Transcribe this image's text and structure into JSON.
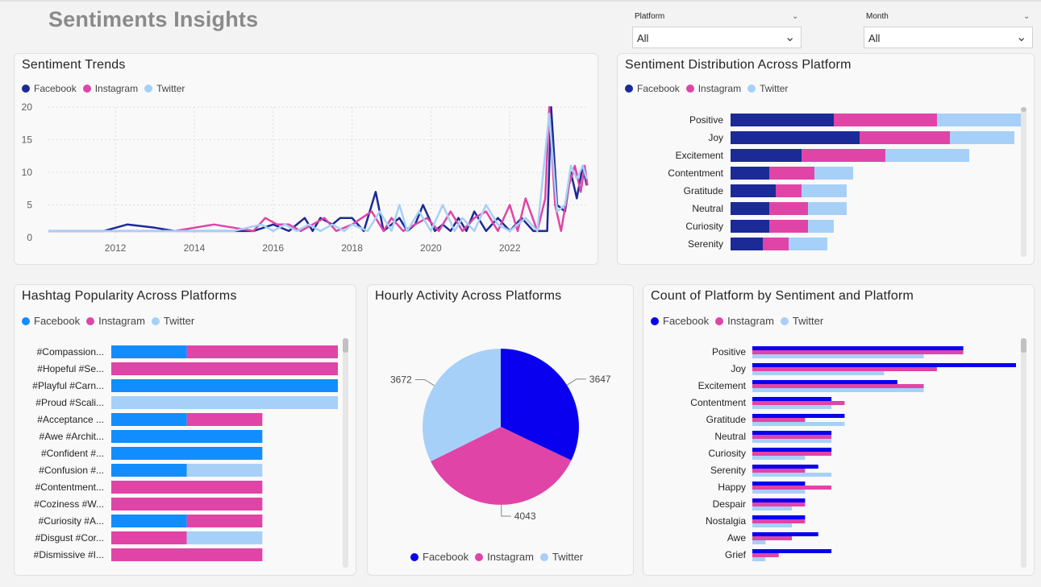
{
  "page": {
    "title": "Sentiments Insights"
  },
  "filters": {
    "platform": {
      "label": "Platform",
      "value": "All"
    },
    "month": {
      "label": "Month",
      "value": "All"
    }
  },
  "colors": {
    "facebook_dark": "#1b2a96",
    "instagram": "#e044a7",
    "twitter": "#a6d0f7",
    "facebook_blue": "#118dff",
    "facebook_bright": "#0a00f0"
  },
  "panels": {
    "trends": {
      "title": "Sentiment Trends"
    },
    "distribution": {
      "title": "Sentiment Distribution Across Platform"
    },
    "hashtags": {
      "title": "Hashtag Popularity Across Platforms"
    },
    "hourly": {
      "title": "Hourly Activity Across Platforms"
    },
    "count": {
      "title": "Count of Platform by Sentiment and Platform"
    }
  },
  "chart_data": [
    {
      "id": "trends",
      "type": "line",
      "title": "Sentiment Trends",
      "legend": [
        "Facebook",
        "Instagram",
        "Twitter"
      ],
      "legend_position": "top-left",
      "x_ticks": [
        "2012",
        "2014",
        "2016",
        "2018",
        "2020",
        "2022"
      ],
      "y_ticks": [
        "0",
        "5",
        "10",
        "15",
        "20"
      ],
      "xlim": [
        2010.3,
        2024.0
      ],
      "ylim": [
        0,
        20
      ],
      "grid": true,
      "series": [
        {
          "name": "Facebook",
          "points": [
            [
              2010.3,
              1
            ],
            [
              2011.0,
              1
            ],
            [
              2011.7,
              1
            ],
            [
              2012.3,
              2
            ],
            [
              2013.0,
              1.5
            ],
            [
              2013.5,
              1
            ],
            [
              2014.5,
              1
            ],
            [
              2015.5,
              1
            ],
            [
              2016.0,
              2
            ],
            [
              2016.4,
              1
            ],
            [
              2016.8,
              3
            ],
            [
              2017.0,
              1
            ],
            [
              2017.2,
              3
            ],
            [
              2017.5,
              2
            ],
            [
              2017.7,
              3
            ],
            [
              2018.0,
              3
            ],
            [
              2018.3,
              1
            ],
            [
              2018.6,
              7
            ],
            [
              2018.8,
              1
            ],
            [
              2019.2,
              3
            ],
            [
              2019.4,
              1
            ],
            [
              2019.6,
              2
            ],
            [
              2019.8,
              5
            ],
            [
              2020.1,
              1
            ],
            [
              2020.3,
              2
            ],
            [
              2020.5,
              1
            ],
            [
              2020.7,
              3
            ],
            [
              2020.9,
              1
            ],
            [
              2021.1,
              4
            ],
            [
              2021.4,
              1
            ],
            [
              2021.7,
              3
            ],
            [
              2022.0,
              1
            ],
            [
              2022.3,
              3
            ],
            [
              2022.6,
              1
            ],
            [
              2022.8,
              1
            ],
            [
              2022.95,
              1
            ],
            [
              2023.05,
              20
            ],
            [
              2023.2,
              5
            ],
            [
              2023.4,
              4
            ],
            [
              2023.55,
              10
            ],
            [
              2023.7,
              6
            ],
            [
              2023.85,
              11
            ],
            [
              2023.95,
              8
            ]
          ]
        },
        {
          "name": "Instagram",
          "points": [
            [
              2010.3,
              1
            ],
            [
              2011.0,
              1
            ],
            [
              2012.0,
              1
            ],
            [
              2013.0,
              1
            ],
            [
              2013.5,
              1
            ],
            [
              2014.5,
              2
            ],
            [
              2015.0,
              1.5
            ],
            [
              2015.5,
              1
            ],
            [
              2015.8,
              3
            ],
            [
              2016.1,
              2
            ],
            [
              2016.4,
              2
            ],
            [
              2016.7,
              1
            ],
            [
              2017.0,
              2
            ],
            [
              2017.3,
              3
            ],
            [
              2017.6,
              1
            ],
            [
              2018.0,
              2
            ],
            [
              2018.5,
              4
            ],
            [
              2018.8,
              1
            ],
            [
              2019.0,
              3
            ],
            [
              2019.3,
              1
            ],
            [
              2019.6,
              2
            ],
            [
              2019.9,
              3
            ],
            [
              2020.2,
              1
            ],
            [
              2020.5,
              4
            ],
            [
              2020.8,
              1
            ],
            [
              2021.1,
              3
            ],
            [
              2021.4,
              4
            ],
            [
              2021.7,
              1
            ],
            [
              2022.0,
              5
            ],
            [
              2022.2,
              1
            ],
            [
              2022.4,
              6
            ],
            [
              2022.7,
              1
            ],
            [
              2022.9,
              6
            ],
            [
              2023.0,
              20
            ],
            [
              2023.15,
              5
            ],
            [
              2023.3,
              1
            ],
            [
              2023.5,
              8
            ],
            [
              2023.65,
              11
            ],
            [
              2023.8,
              7
            ],
            [
              2023.9,
              11
            ],
            [
              2023.97,
              8
            ]
          ]
        },
        {
          "name": "Twitter",
          "points": [
            [
              2010.3,
              1
            ],
            [
              2011.0,
              1
            ],
            [
              2012.0,
              1
            ],
            [
              2013.0,
              1
            ],
            [
              2014.0,
              1
            ],
            [
              2015.0,
              1
            ],
            [
              2015.7,
              2
            ],
            [
              2016.0,
              1
            ],
            [
              2016.3,
              2
            ],
            [
              2016.6,
              1
            ],
            [
              2016.9,
              2
            ],
            [
              2017.2,
              1
            ],
            [
              2017.5,
              2
            ],
            [
              2017.8,
              1
            ],
            [
              2018.0,
              2
            ],
            [
              2018.4,
              1
            ],
            [
              2018.7,
              4
            ],
            [
              2019.0,
              1
            ],
            [
              2019.2,
              5
            ],
            [
              2019.4,
              1
            ],
            [
              2019.7,
              4
            ],
            [
              2020.0,
              1
            ],
            [
              2020.3,
              5
            ],
            [
              2020.6,
              1
            ],
            [
              2020.8,
              3
            ],
            [
              2021.1,
              1
            ],
            [
              2021.4,
              5
            ],
            [
              2021.7,
              2
            ],
            [
              2022.0,
              1
            ],
            [
              2022.4,
              3
            ],
            [
              2022.7,
              1
            ],
            [
              2023.0,
              19
            ],
            [
              2023.2,
              4
            ],
            [
              2023.4,
              5
            ],
            [
              2023.55,
              11
            ],
            [
              2023.7,
              9
            ],
            [
              2023.85,
              11
            ],
            [
              2023.95,
              9
            ]
          ]
        }
      ]
    },
    {
      "id": "distribution",
      "type": "bar",
      "orientation": "horizontal",
      "stacked": true,
      "title": "Sentiment Distribution Across Platform",
      "legend": [
        "Facebook",
        "Instagram",
        "Twitter"
      ],
      "legend_position": "top-left",
      "categories": [
        "Positive",
        "Joy",
        "Excitement",
        "Contentment",
        "Gratitude",
        "Neutral",
        "Curiosity",
        "Serenity"
      ],
      "xlim": [
        0,
        50
      ],
      "series": [
        {
          "name": "Facebook",
          "values": [
            16,
            20,
            11,
            6,
            7,
            6,
            6,
            5
          ]
        },
        {
          "name": "Instagram",
          "values": [
            16,
            14,
            13,
            7,
            4,
            6,
            6,
            4
          ]
        },
        {
          "name": "Twitter",
          "values": [
            13,
            10,
            13,
            6,
            7,
            6,
            4,
            6
          ]
        }
      ]
    },
    {
      "id": "hashtags",
      "type": "bar",
      "orientation": "horizontal",
      "stacked": true,
      "title": "Hashtag Popularity Across Platforms",
      "legend": [
        "Facebook",
        "Instagram",
        "Twitter"
      ],
      "legend_position": "top-left",
      "categories": [
        "#Compassion...",
        "#Hopeful #Se...",
        "#Playful #Carn...",
        "#Proud #Scali...",
        "#Acceptance ...",
        "#Awe #Archit...",
        "#Confident #...",
        "#Confusion #...",
        "#Contentment...",
        "#Coziness #W...",
        "#Curiosity #A...",
        "#Disgust #Cor...",
        "#Dismissive #I..."
      ],
      "xlim": [
        0,
        3
      ],
      "series": [
        {
          "name": "Facebook",
          "values": [
            1,
            0,
            3,
            0,
            1,
            2,
            2,
            1,
            0,
            0,
            1,
            0,
            0
          ]
        },
        {
          "name": "Instagram",
          "values": [
            2,
            3,
            0,
            0,
            1,
            0,
            0,
            0,
            2,
            2,
            1,
            1,
            2
          ]
        },
        {
          "name": "Twitter",
          "values": [
            0,
            0,
            0,
            3,
            0,
            0,
            0,
            1,
            0,
            0,
            0,
            1,
            0
          ]
        }
      ]
    },
    {
      "id": "hourly",
      "type": "pie",
      "title": "Hourly Activity Across Platforms",
      "legend": [
        "Facebook",
        "Instagram",
        "Twitter"
      ],
      "legend_position": "bottom",
      "slices": [
        {
          "name": "Facebook",
          "value": 3647,
          "label": "3647"
        },
        {
          "name": "Instagram",
          "value": 4043,
          "label": "4043"
        },
        {
          "name": "Twitter",
          "value": 3672,
          "label": "3672"
        }
      ]
    },
    {
      "id": "count",
      "type": "bar",
      "orientation": "horizontal",
      "stacked": false,
      "title": "Count of Platform by Sentiment and Platform",
      "legend": [
        "Facebook",
        "Instagram",
        "Twitter"
      ],
      "legend_position": "top-left",
      "categories": [
        "Positive",
        "Joy",
        "Excitement",
        "Contentment",
        "Gratitude",
        "Neutral",
        "Curiosity",
        "Serenity",
        "Happy",
        "Despair",
        "Nostalgia",
        "Awe",
        "Grief"
      ],
      "xlim": [
        0,
        20
      ],
      "series": [
        {
          "name": "Facebook",
          "values": [
            16,
            20,
            11,
            6,
            7,
            6,
            6,
            5,
            4,
            4,
            4,
            5,
            6
          ]
        },
        {
          "name": "Instagram",
          "values": [
            16,
            14,
            13,
            7,
            4,
            6,
            6,
            4,
            6,
            4,
            4,
            3,
            2
          ]
        },
        {
          "name": "Twitter",
          "values": [
            13,
            10,
            13,
            6,
            7,
            6,
            4,
            6,
            4,
            3,
            3,
            1,
            1
          ]
        }
      ]
    }
  ]
}
